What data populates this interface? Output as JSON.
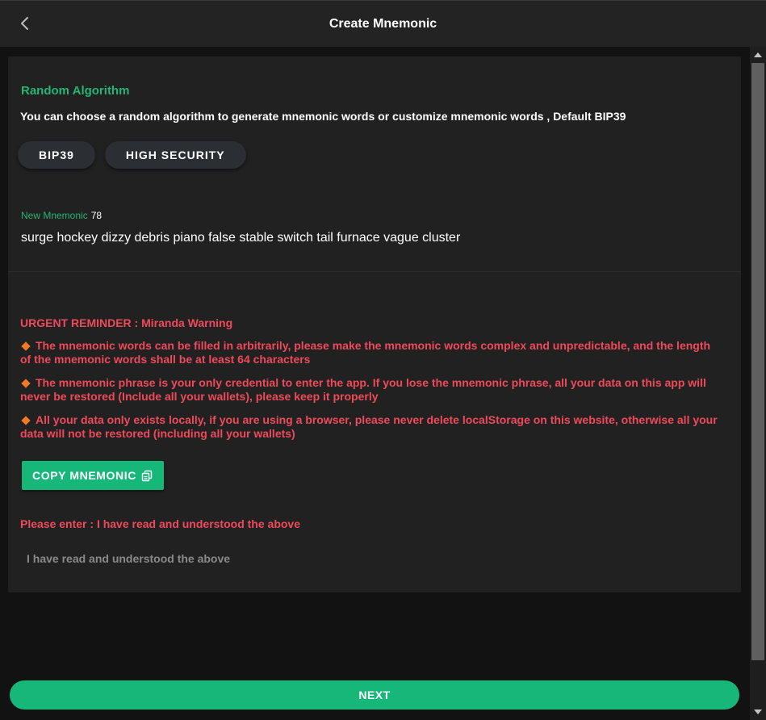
{
  "header": {
    "title": "Create Mnemonic",
    "back_icon": "chevron-left-icon"
  },
  "algorithm": {
    "title": "Random Algorithm",
    "description": "You can choose a random algorithm to generate mnemonic words or customize mnemonic words , Default BIP39",
    "options": [
      "BIP39",
      "HIGH SECURITY"
    ]
  },
  "mnemonic": {
    "label": "New Mnemonic",
    "length": "78",
    "words": "surge hockey dizzy debris piano false stable switch tail furnace vague cluster"
  },
  "warning": {
    "title": "URGENT REMINDER : Miranda Warning",
    "items": [
      "The mnemonic words can be filled in arbitrarily, please make the mnemonic words complex and unpredictable, and the length of the mnemonic words shall be at least 64 characters",
      "The mnemonic phrase is your only credential to enter the app. If you lose the mnemonic phrase, all your data on this app will never be restored (Include all your wallets), please keep it properly",
      "All your data only exists locally, if you are using a browser, please never delete localStorage on this website, otherwise all your data will not be restored (including all your wallets)"
    ]
  },
  "copy_button": {
    "label": "COPY MNEMONIC",
    "icon": "copy-icon"
  },
  "confirm": {
    "label": "Please enter : I have read and understood the above",
    "placeholder": "I have read and understood the above",
    "value": ""
  },
  "next_button": {
    "label": "NEXT"
  },
  "colors": {
    "accent_green": "#17b77a",
    "title_green": "#23b574",
    "warning_red": "#ef4a5a",
    "bullet_orange": "#f07a24",
    "background": "#121212",
    "card": "#212121"
  }
}
